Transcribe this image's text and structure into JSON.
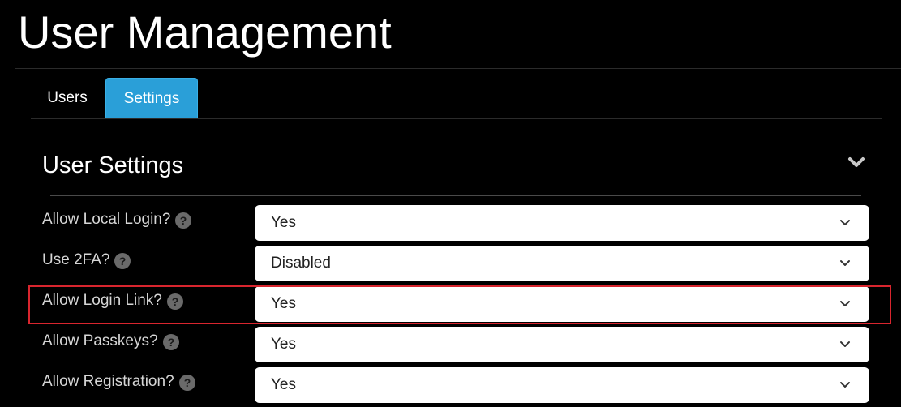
{
  "page": {
    "title": "User Management"
  },
  "tabs": [
    {
      "label": "Users",
      "active": false
    },
    {
      "label": "Settings",
      "active": true
    }
  ],
  "section": {
    "title": "User Settings",
    "collapse_icon": "chevron-down-icon"
  },
  "settings": [
    {
      "label": "Allow Local Login?",
      "value": "Yes",
      "help_icon": "question-circle-icon"
    },
    {
      "label": "Use 2FA?",
      "value": "Disabled",
      "help_icon": "question-circle-icon"
    },
    {
      "label": "Allow Login Link?",
      "value": "Yes",
      "help_icon": "question-circle-icon",
      "highlighted": true
    },
    {
      "label": "Allow Passkeys?",
      "value": "Yes",
      "help_icon": "question-circle-icon"
    },
    {
      "label": "Allow Registration?",
      "value": "Yes",
      "help_icon": "question-circle-icon"
    }
  ],
  "colors": {
    "background": "#000000",
    "accent": "#2a9fd8",
    "highlight": "#d9252e",
    "select_background": "#ffffff"
  }
}
